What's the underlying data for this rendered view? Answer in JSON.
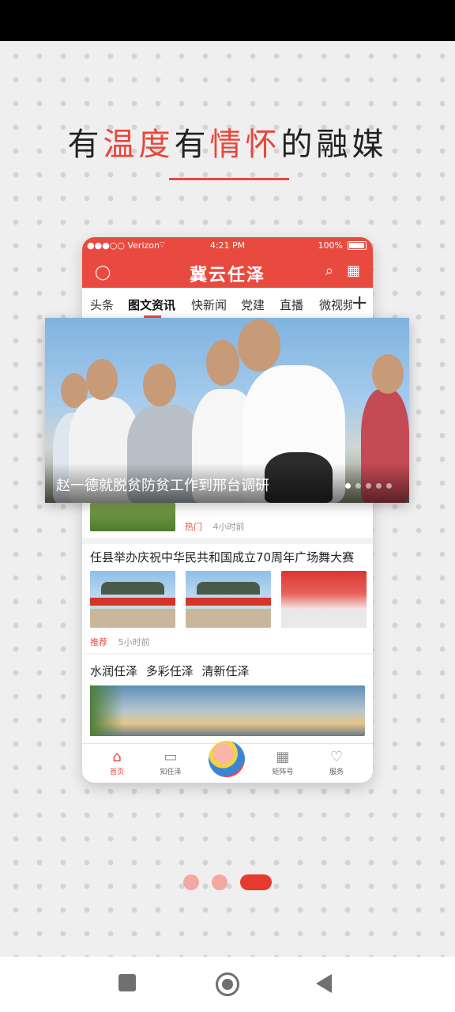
{
  "promo": {
    "headline_parts": [
      "有",
      "温度",
      "有",
      "情怀",
      "的融媒"
    ],
    "accent_color": "#e8463b"
  },
  "phone": {
    "status": {
      "carrier": "●●●○○ Verizon",
      "wifi_icon": "wifi-icon",
      "time": "4:21 PM",
      "battery": "100%"
    },
    "header": {
      "title": "冀云任泽",
      "user_icon": "user-icon",
      "search_icon": "search-icon",
      "map_icon": "map-icon"
    },
    "tabs": [
      {
        "label": "头条"
      },
      {
        "label": "图文资讯",
        "active": true
      },
      {
        "label": "快新闻"
      },
      {
        "label": "党建"
      },
      {
        "label": "直播"
      },
      {
        "label": "微视频"
      }
    ],
    "tabs_more_icon": "+",
    "banner": {
      "caption": "赵一德就脱贫防贫工作到邢台调研",
      "slides": 5,
      "active_slide": 1
    },
    "news": [
      {
        "tag": "热门",
        "time": "4小时前"
      },
      {
        "title": "任县举办庆祝中华民共和国成立70周年广场舞大赛",
        "tag": "推荐",
        "time": "5小时前"
      },
      {
        "title": "水润任泽 多彩任泽 清新任泽"
      }
    ],
    "bottom_nav": [
      {
        "label": "首页",
        "icon": "home-icon",
        "active": true
      },
      {
        "label": "知任泽",
        "icon": "monitor-icon"
      },
      {
        "label": "",
        "icon": "app-logo-icon"
      },
      {
        "label": "矩阵号",
        "icon": "grid-icon"
      },
      {
        "label": "服务",
        "icon": "heart-icon"
      }
    ]
  },
  "pager": {
    "count": 3,
    "active": 3
  },
  "system_nav": [
    "recents-button",
    "home-button",
    "back-button"
  ]
}
